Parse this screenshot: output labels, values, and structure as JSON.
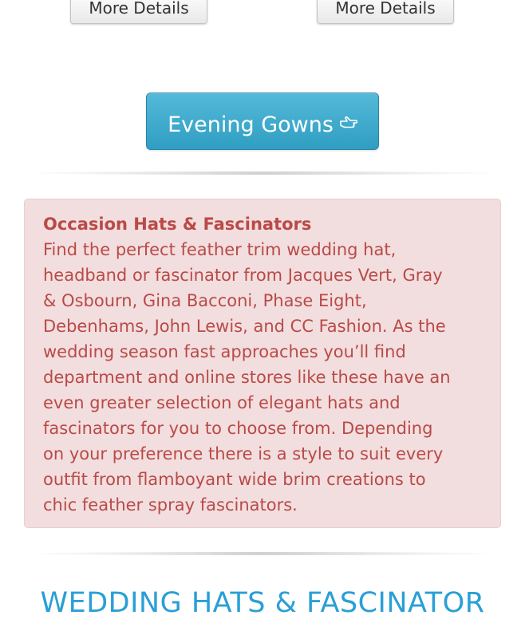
{
  "products": [
    {
      "more_details_label": "More Details"
    },
    {
      "more_details_label": "More Details"
    }
  ],
  "evening_gowns_button": {
    "label": "Evening Gowns",
    "icon": "hand-pointer-right-icon"
  },
  "alert": {
    "title": "Occasion Hats & Fascinators",
    "body": "Find the perfect feather trim wedding hat, headband or fascinator from Jacques Vert, Gray & Osbourn, Gina Bacconi, Phase Eight, Debenhams, John Lewis, and CC Fashion. As the wedding season fast approaches you’ll find department and online stores like these have an even greater selection of elegant hats and fascinators for you to choose from. Depending on your preference there is a style to suit every outfit from flamboyant wide brim creations to chic feather spray fascinators."
  },
  "section_heading": "WEDDING HATS & FASCINATOR",
  "colors": {
    "primary_button": "#31a0c4",
    "alert_background": "#f2dede",
    "alert_text": "#b94a48",
    "heading": "#2a9fd6"
  }
}
